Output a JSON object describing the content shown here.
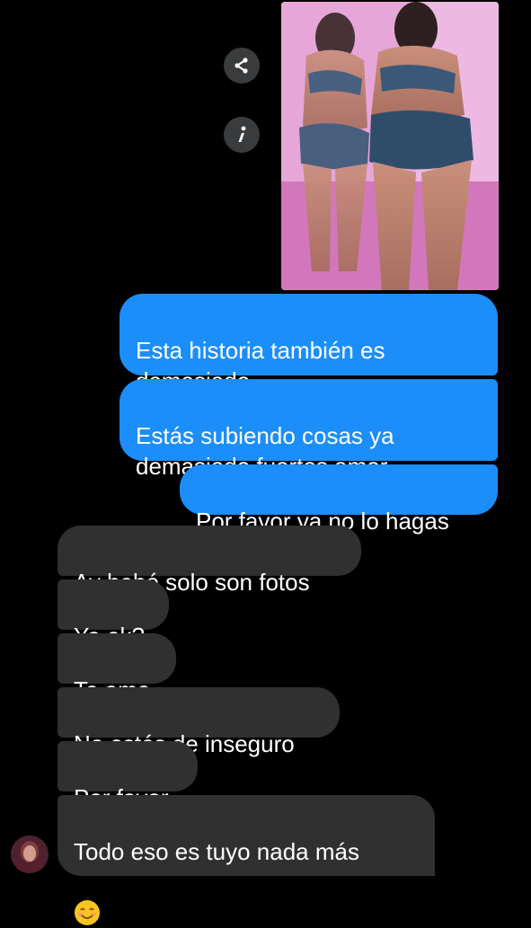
{
  "colors": {
    "background": "#000000",
    "sent_bubble": "#1c8ef9",
    "received_bubble": "#303030",
    "action_button": "#3a3b3c",
    "text": "#ffffff"
  },
  "shared_story": {
    "share_icon": "share-icon",
    "info_icon": "info-icon",
    "image_icon": "photo-thumbnail"
  },
  "messages": {
    "sent": [
      {
        "text": "Esta historia también es\ndemasiado"
      },
      {
        "text": "Estás subiendo cosas ya\ndemasiado fuertes amor"
      },
      {
        "text": "Por favor ya no lo hagas"
      }
    ],
    "received": [
      {
        "text": "Ay bebé solo son fotos"
      },
      {
        "text": "Ya ok?"
      },
      {
        "text": "Te amo"
      },
      {
        "text": "No estés de inseguro"
      },
      {
        "text": "Por favor"
      },
      {
        "text": "Todo eso es tuyo nada más",
        "emoji": "smiling-face-emoji"
      }
    ]
  }
}
